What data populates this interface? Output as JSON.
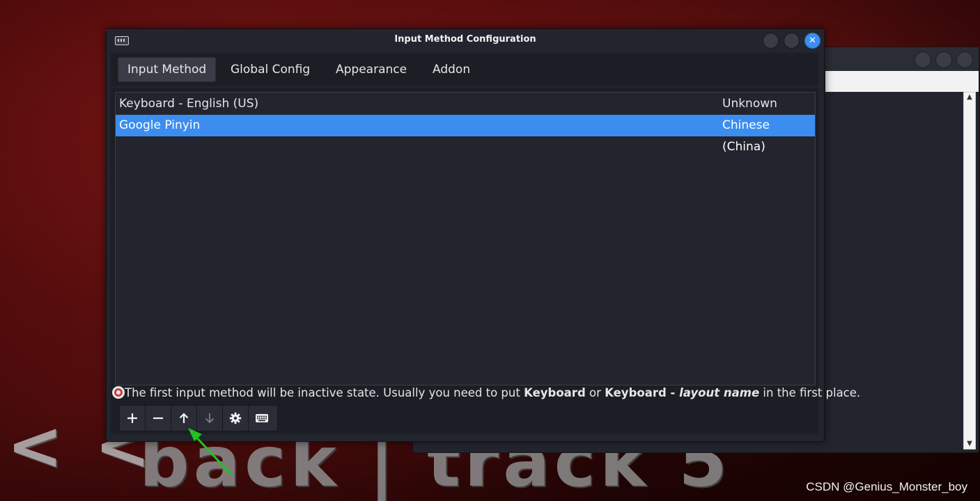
{
  "window": {
    "title": "Input Method Configuration"
  },
  "tabs": [
    {
      "label": "Input Method",
      "active": true
    },
    {
      "label": "Global Config",
      "active": false
    },
    {
      "label": "Appearance",
      "active": false
    },
    {
      "label": "Addon",
      "active": false
    }
  ],
  "input_methods": [
    {
      "name": "Keyboard - English (US)",
      "language": "Unknown",
      "selected": false
    },
    {
      "name": "Google Pinyin",
      "language": "Chinese (China)",
      "selected": true
    }
  ],
  "info": {
    "prefix": "The first input method will be inactive state. Usually you need to put ",
    "keyword1": "Keyboard",
    "middle": " or ",
    "keyword2": "Keyboard - ",
    "keyword2_italic": "layout name",
    "suffix": " in the first place."
  },
  "toolbar": [
    {
      "name": "add-button",
      "icon": "plus-icon",
      "enabled": true
    },
    {
      "name": "remove-button",
      "icon": "minus-icon",
      "enabled": true
    },
    {
      "name": "move-up-button",
      "icon": "arrow-up-icon",
      "enabled": true
    },
    {
      "name": "move-down-button",
      "icon": "arrow-down-icon",
      "enabled": false
    },
    {
      "name": "configure-button",
      "icon": "gear-icon",
      "enabled": true
    },
    {
      "name": "keyboard-layout-button",
      "icon": "keyboard-icon",
      "enabled": true
    }
  ],
  "background": {
    "logo_chevrons": "< <",
    "logo_text": "back | track 5",
    "watermark": "CSDN @Genius_Monster_boy"
  },
  "colors": {
    "accent": "#3b8ef0",
    "window_bg": "#23252e",
    "annotation_arrow": "#22c222"
  }
}
